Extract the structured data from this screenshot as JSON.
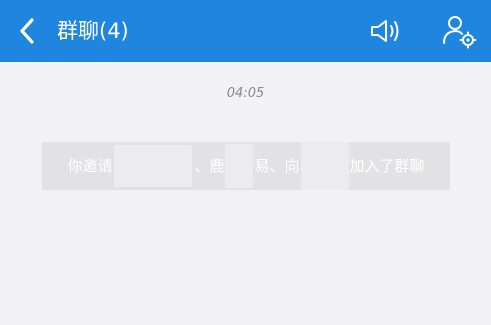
{
  "header": {
    "back_icon": "chevron-left-icon",
    "title": "群聊(4)",
    "speaker_icon": "speaker-icon",
    "profile_icon": "group-settings-icon",
    "bg_color": "#1e86de"
  },
  "chat": {
    "timestamp": "04:05",
    "system_message": {
      "part1": "你邀请",
      "sep1": "、",
      "part2": "鹿",
      "part3": "易",
      "sep2": "、",
      "part4": "向",
      "part5": "加入了群聊"
    }
  }
}
